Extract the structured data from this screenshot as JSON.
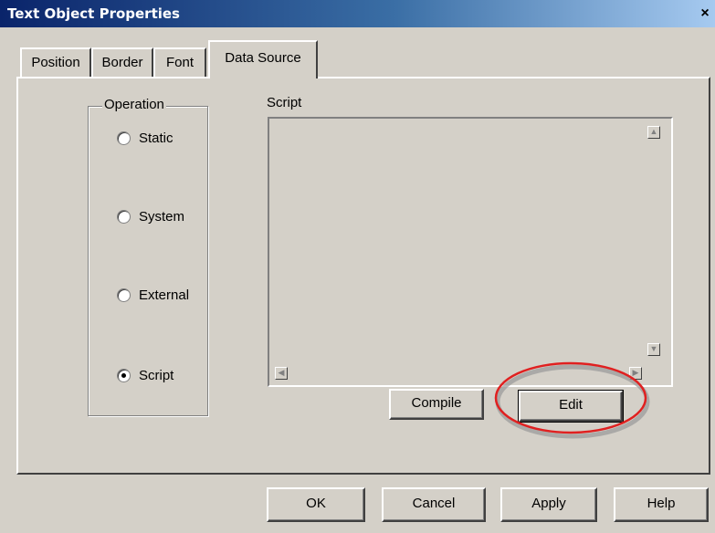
{
  "window": {
    "title": "Text Object Properties",
    "close_glyph": "×"
  },
  "tabs": [
    {
      "label": "Position"
    },
    {
      "label": "Border"
    },
    {
      "label": "Font"
    },
    {
      "label": "Data Source",
      "active": true
    }
  ],
  "operation": {
    "label": "Operation",
    "options": [
      {
        "label": "Static",
        "selected": false
      },
      {
        "label": "System",
        "selected": false
      },
      {
        "label": "External",
        "selected": false
      },
      {
        "label": "Script",
        "selected": true
      }
    ]
  },
  "script": {
    "label": "Script",
    "value": ""
  },
  "panel_buttons": {
    "compile": "Compile",
    "edit": "Edit"
  },
  "footer_buttons": {
    "ok": "OK",
    "cancel": "Cancel",
    "apply": "Apply",
    "help": "Help"
  },
  "colors": {
    "annotation": "#e02020",
    "face": "#d4d0c8",
    "titlebar": "#0a246a"
  }
}
